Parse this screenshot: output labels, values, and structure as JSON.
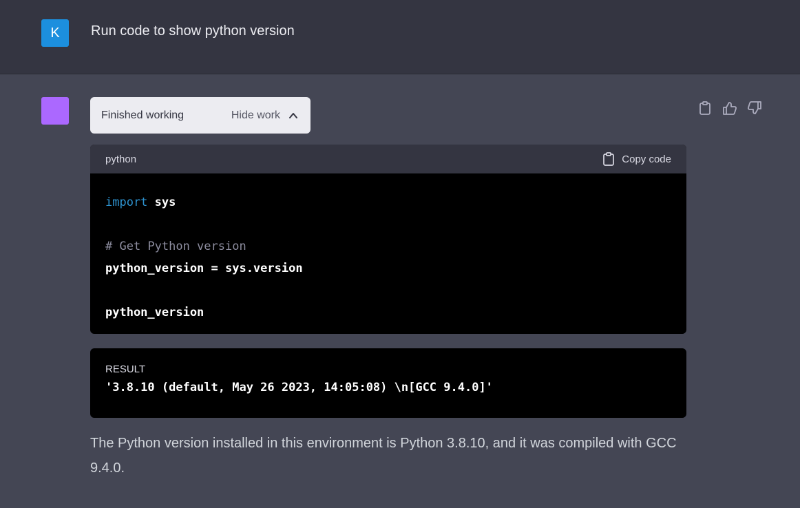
{
  "user_message": {
    "avatar_letter": "K",
    "text": "Run code to show python version"
  },
  "assistant": {
    "work_status": "Finished working",
    "hide_work_label": "Hide work",
    "actions": [
      "copy-icon",
      "thumbs-up-icon",
      "thumbs-down-icon"
    ],
    "code": {
      "language": "python",
      "copy_label": "Copy code",
      "lines": [
        {
          "keyword": "import",
          "rest": " sys"
        },
        {
          "text": ""
        },
        {
          "comment": "# Get Python version"
        },
        {
          "text": "python_version = sys.version"
        },
        {
          "text": ""
        },
        {
          "text": "python_version"
        }
      ]
    },
    "result": {
      "label": "RESULT",
      "text": "'3.8.10 (default, May 26 2023, 14:05:08) \\n[GCC 9.4.0]'"
    },
    "answer": "The Python version installed in this environment is Python 3.8.10, and it was compiled with GCC 9.4.0."
  },
  "colors": {
    "user_avatar": "#1c8fde",
    "bot_avatar": "#ab68ff",
    "keyword": "#2e95d3",
    "comment": "#8e8ea0"
  }
}
